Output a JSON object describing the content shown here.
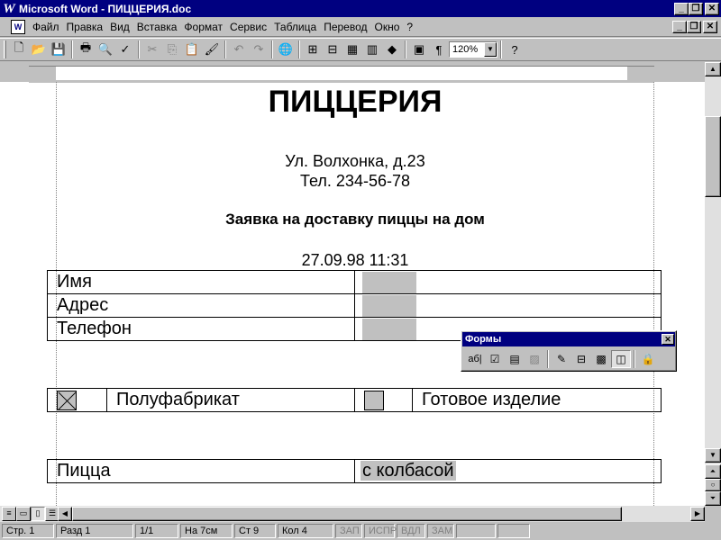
{
  "window": {
    "title": "Microsoft Word - ПИЦЦЕРИЯ.doc"
  },
  "menu": [
    "Файл",
    "Правка",
    "Вид",
    "Вставка",
    "Формат",
    "Сервис",
    "Таблица",
    "Перевод",
    "Окно",
    "?"
  ],
  "toolbar": {
    "zoom": "120%"
  },
  "document": {
    "title": "ПИЦЦЕРИЯ",
    "address": "Ул. Волхонка, д.23",
    "phone": "Тел. 234-56-78",
    "order_heading": "Заявка на доставку пиццы на дом",
    "datetime": "27.09.98 11:31",
    "fields": [
      {
        "label": "Имя"
      },
      {
        "label": "Адрес"
      },
      {
        "label": "Телефон"
      }
    ],
    "options": [
      {
        "label": "Полуфабрикат",
        "checked": true
      },
      {
        "label": "Готовое изделие",
        "checked": false
      }
    ],
    "pizza": {
      "label": "Пицца",
      "value": "с колбасой"
    }
  },
  "forms_toolbar": {
    "title": "Формы",
    "text_field_icon_label": "аб|"
  },
  "status": {
    "page": "Стр. 1",
    "section": "Разд 1",
    "pages": "1/1",
    "at": "На 7см",
    "line": "Ст 9",
    "col": "Кол 4",
    "rec": "ЗАП",
    "trk": "ИСПР",
    "ext": "ВДЛ",
    "ovr": "ЗАМ"
  }
}
